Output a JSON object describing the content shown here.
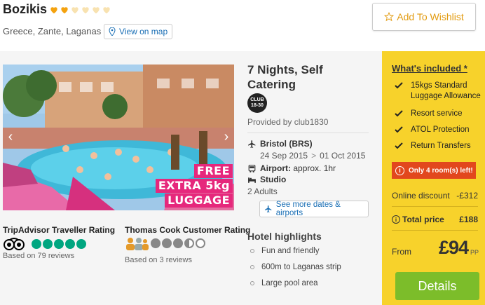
{
  "hotel": {
    "name": "Bozikis",
    "rating_hearts": 2,
    "max_hearts": 6,
    "location": "Greece, Zante, Laganas",
    "map_label": "View on map"
  },
  "wishlist_label": "Add To Wishlist",
  "promo": {
    "line1": "FREE",
    "line2": "EXTRA 5kg",
    "line3": "LUGGAGE"
  },
  "tripadvisor": {
    "title": "TripAdvisor Traveller Rating",
    "reviews": "Based on 79 reviews",
    "score": 5
  },
  "thomascook": {
    "title": "Thomas Cook Customer Rating",
    "reviews": "Based on 3 reviews",
    "score": 3.5
  },
  "offer": {
    "title": "7 Nights, Self Catering",
    "logo_text": "CLUB 18-30",
    "provided_by": "Provided by club1830",
    "departure": "Bristol (BRS)",
    "dates_from": "24 Sep 2015",
    "dates_to": "01 Oct 2015",
    "transfer_label": "Airport:",
    "transfer_value": "approx. 1hr",
    "room": "Studio",
    "guests": "2 Adults",
    "see_more": "See more dates & airports"
  },
  "highlights": {
    "title": "Hotel highlights",
    "items": [
      "Fun and friendly",
      "600m to Laganas strip",
      "Large pool area"
    ]
  },
  "included": {
    "title": "What's included *",
    "items": [
      "15kgs Standard Luggage Allowance",
      "Resort service",
      "ATOL Protection",
      "Return Transfers"
    ]
  },
  "rooms_left": "Only 4 room(s) left!",
  "pricing": {
    "discount_label": "Online discount",
    "discount_value": "-£312",
    "total_label": "Total price",
    "total_value": "£188",
    "from_label": "From",
    "price": "£94",
    "pp": "PP"
  },
  "details_label": "Details",
  "colors": {
    "accent_yellow": "#f7d22b",
    "green": "#7cbd2a",
    "alert": "#e2471d",
    "link": "#1a6fb5",
    "heart": "#f4a20f"
  }
}
